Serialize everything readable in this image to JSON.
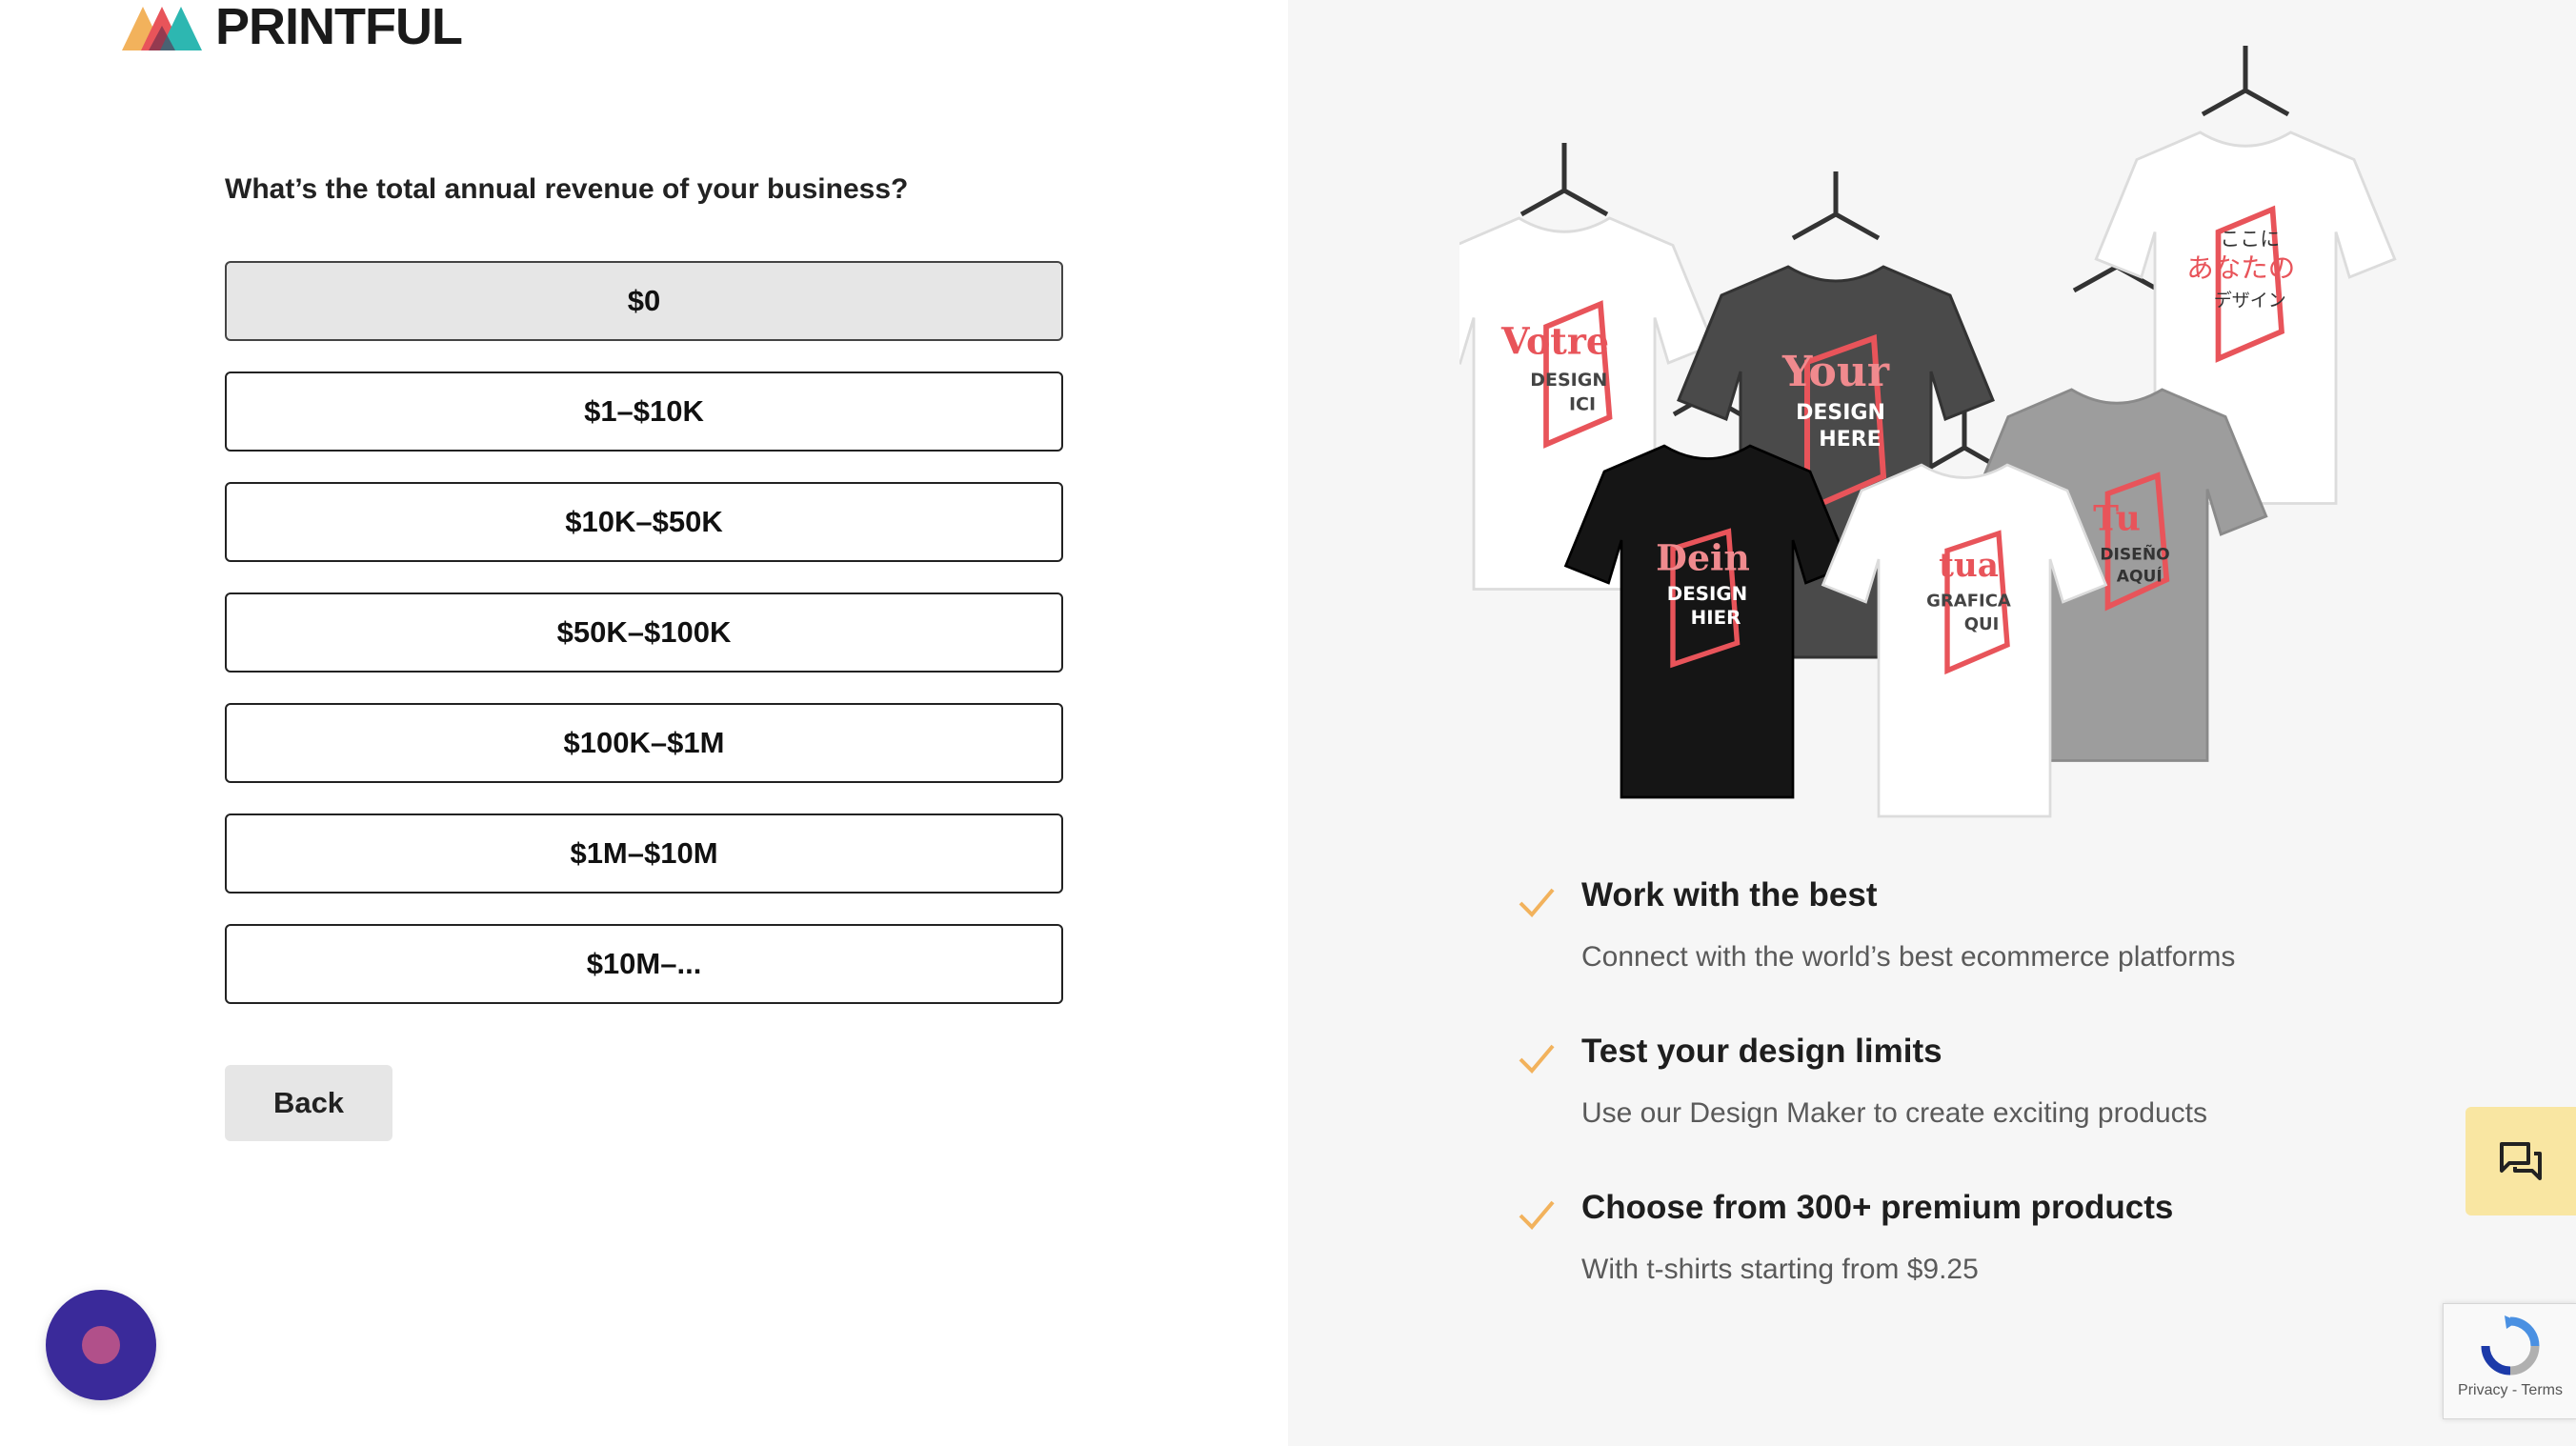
{
  "brand": {
    "name": "PRINTFUL"
  },
  "question": "What’s the total annual revenue of your business?",
  "options": [
    {
      "label": "$0",
      "selected": true
    },
    {
      "label": "$1–$10K",
      "selected": false
    },
    {
      "label": "$10K–$50K",
      "selected": false
    },
    {
      "label": "$50K–$100K",
      "selected": false
    },
    {
      "label": "$100K–$1M",
      "selected": false
    },
    {
      "label": "$1M–$10M",
      "selected": false
    },
    {
      "label": "$10M–...",
      "selected": false
    }
  ],
  "back_label": "Back",
  "hero": {
    "shirts": [
      {
        "line1": "Votre",
        "line2": "DESIGN",
        "line3": "ICI"
      },
      {
        "line1": "Your",
        "line2": "DESIGN",
        "line3": "HERE"
      },
      {
        "line1": "ここに",
        "line2": "あなたの",
        "line3": "デザイン"
      },
      {
        "line1": "Tu",
        "line2": "DISEÑO",
        "line3": "AQUÍ"
      },
      {
        "line1": "Dein",
        "line2": "DESIGN",
        "line3": "HIER"
      },
      {
        "line1": "tua",
        "line2": "GRAFICA",
        "line3": "QUI"
      }
    ]
  },
  "features": [
    {
      "title": "Work with the best",
      "desc": "Connect with the world’s best ecommerce platforms"
    },
    {
      "title": "Test your design limits",
      "desc": "Use our Design Maker to create exciting products"
    },
    {
      "title": "Choose from 300+ premium products",
      "desc": "With t-shirts starting from $9.25"
    }
  ],
  "recaptcha": {
    "links": "Privacy - Terms"
  },
  "colors": {
    "check": "#f2b25c",
    "accent": "#e8545a",
    "chat_tab": "#f9e6a2",
    "help_bubble": "#3a2a9a"
  },
  "icons": {
    "check": "check-icon",
    "chat": "chat-icon",
    "help": "help-bubble-icon",
    "recaptcha": "recaptcha-icon"
  }
}
